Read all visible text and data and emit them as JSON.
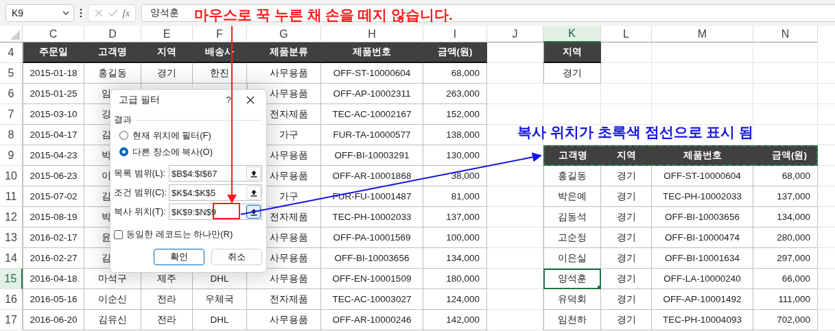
{
  "formula_bar": {
    "name_box": "K9",
    "function_label": "fx",
    "value": "양석훈"
  },
  "sheet": {
    "columns": [
      {
        "label": "C",
        "selected": false
      },
      {
        "label": "D",
        "selected": false
      },
      {
        "label": "E",
        "selected": false
      },
      {
        "label": "F",
        "selected": false
      },
      {
        "label": "G",
        "selected": false
      },
      {
        "label": "H",
        "selected": false
      },
      {
        "label": "I",
        "selected": false
      },
      {
        "label": "J",
        "selected": false
      },
      {
        "label": "K",
        "selected": true
      },
      {
        "label": "L",
        "selected": false
      },
      {
        "label": "M",
        "selected": false
      },
      {
        "label": "N",
        "selected": false
      }
    ],
    "rows": [
      {
        "label": "4",
        "selected": false,
        "copy_marquee": false,
        "cells": [
          {
            "kind": "header",
            "text": "주문일"
          },
          {
            "kind": "header",
            "text": "고객명"
          },
          {
            "kind": "header",
            "text": "지역"
          },
          {
            "kind": "header",
            "text": "배송사"
          },
          {
            "kind": "header",
            "text": "제품분류"
          },
          {
            "kind": "header",
            "text": "제품번호"
          },
          {
            "kind": "header",
            "text": "금액(원)"
          },
          null,
          {
            "kind": "header",
            "text": "지역"
          },
          null,
          null,
          null
        ]
      },
      {
        "label": "5",
        "selected": false,
        "copy_marquee": false,
        "cells": [
          {
            "kind": "text",
            "text": "2015-01-18"
          },
          {
            "kind": "text",
            "text": "홍길동"
          },
          {
            "kind": "text",
            "text": "경기"
          },
          {
            "kind": "text",
            "text": "한진"
          },
          {
            "kind": "text",
            "text": "사무용품"
          },
          {
            "kind": "text",
            "text": "OFF-ST-10000604"
          },
          {
            "kind": "number",
            "text": "68,000"
          },
          null,
          {
            "kind": "text",
            "text": "경기"
          },
          null,
          null,
          null
        ]
      },
      {
        "label": "6",
        "selected": false,
        "copy_marquee": false,
        "cells": [
          {
            "kind": "text",
            "text": "2015-01-25"
          },
          {
            "kind": "partial",
            "text": "임"
          },
          null,
          null,
          {
            "kind": "text",
            "text": "사무용품"
          },
          {
            "kind": "text",
            "text": "OFF-AP-10002311"
          },
          {
            "kind": "number",
            "text": "263,000"
          },
          null,
          null,
          null,
          null,
          null
        ]
      },
      {
        "label": "7",
        "selected": false,
        "copy_marquee": false,
        "cells": [
          {
            "kind": "text",
            "text": "2015-03-10"
          },
          {
            "kind": "partial",
            "text": "강"
          },
          null,
          null,
          {
            "kind": "text",
            "text": "전자제품"
          },
          {
            "kind": "text",
            "text": "TEC-AC-10002167"
          },
          {
            "kind": "number",
            "text": "152,000"
          },
          null,
          null,
          null,
          null,
          null
        ]
      },
      {
        "label": "8",
        "selected": false,
        "copy_marquee": false,
        "cells": [
          {
            "kind": "text",
            "text": "2015-04-17"
          },
          {
            "kind": "partial",
            "text": "김"
          },
          null,
          null,
          {
            "kind": "text",
            "text": "가구"
          },
          {
            "kind": "text",
            "text": "FUR-TA-10000577"
          },
          {
            "kind": "number",
            "text": "138,000"
          },
          null,
          null,
          null,
          null,
          null
        ]
      },
      {
        "label": "9",
        "selected": false,
        "copy_marquee": true,
        "cells": [
          {
            "kind": "text",
            "text": "2015-04-23"
          },
          {
            "kind": "partial",
            "text": "박"
          },
          null,
          null,
          {
            "kind": "text",
            "text": "사무용품"
          },
          {
            "kind": "text",
            "text": "OFF-BI-10003291"
          },
          {
            "kind": "number",
            "text": "130,000"
          },
          null,
          {
            "kind": "header",
            "text": "고객명"
          },
          {
            "kind": "header",
            "text": "지역"
          },
          {
            "kind": "header",
            "text": "제품번호"
          },
          {
            "kind": "header_right",
            "text": "금액(원)"
          }
        ]
      },
      {
        "label": "10",
        "selected": false,
        "copy_marquee": false,
        "cells": [
          {
            "kind": "text",
            "text": "2015-06-23"
          },
          {
            "kind": "partial",
            "text": "이"
          },
          null,
          null,
          {
            "kind": "text",
            "text": "사무용품"
          },
          {
            "kind": "text",
            "text": "OFF-AR-10001868"
          },
          {
            "kind": "number",
            "text": "38,000"
          },
          null,
          {
            "kind": "text",
            "text": "홍길동"
          },
          {
            "kind": "text",
            "text": "경기"
          },
          {
            "kind": "text",
            "text": "OFF-ST-10000604"
          },
          {
            "kind": "number",
            "text": "68,000"
          }
        ]
      },
      {
        "label": "11",
        "selected": false,
        "copy_marquee": false,
        "cells": [
          {
            "kind": "text",
            "text": "2015-07-02"
          },
          {
            "kind": "partial",
            "text": "김"
          },
          null,
          null,
          {
            "kind": "text",
            "text": "가구"
          },
          {
            "kind": "text",
            "text": "FUR-FU-10001487"
          },
          {
            "kind": "number",
            "text": "81,000"
          },
          null,
          {
            "kind": "text",
            "text": "박은예"
          },
          {
            "kind": "text",
            "text": "경기"
          },
          {
            "kind": "text",
            "text": "TEC-PH-10002033"
          },
          {
            "kind": "number",
            "text": "137,000"
          }
        ]
      },
      {
        "label": "12",
        "selected": false,
        "copy_marquee": false,
        "cells": [
          {
            "kind": "text",
            "text": "2015-08-19"
          },
          {
            "kind": "partial",
            "text": "박"
          },
          null,
          null,
          {
            "kind": "text",
            "text": "전자제품"
          },
          {
            "kind": "text",
            "text": "TEC-PH-10002033"
          },
          {
            "kind": "number",
            "text": "137,000"
          },
          null,
          {
            "kind": "text",
            "text": "김동석"
          },
          {
            "kind": "text",
            "text": "경기"
          },
          {
            "kind": "text",
            "text": "OFF-BI-10003656"
          },
          {
            "kind": "number",
            "text": "134,000"
          }
        ]
      },
      {
        "label": "13",
        "selected": false,
        "copy_marquee": false,
        "cells": [
          {
            "kind": "text",
            "text": "2016-02-17"
          },
          {
            "kind": "partial",
            "text": "윤"
          },
          null,
          null,
          {
            "kind": "text",
            "text": "사무용품"
          },
          {
            "kind": "text",
            "text": "OFF-PA-10001569"
          },
          {
            "kind": "number",
            "text": "100,000"
          },
          null,
          {
            "kind": "text",
            "text": "고순정"
          },
          {
            "kind": "text",
            "text": "경기"
          },
          {
            "kind": "text",
            "text": "OFF-BI-10000474"
          },
          {
            "kind": "number",
            "text": "280,000"
          }
        ]
      },
      {
        "label": "14",
        "selected": false,
        "copy_marquee": false,
        "cells": [
          {
            "kind": "text",
            "text": "2016-02-27"
          },
          {
            "kind": "partial",
            "text": "김"
          },
          null,
          null,
          {
            "kind": "text",
            "text": "사무용품"
          },
          {
            "kind": "text",
            "text": "OFF-BI-10003656"
          },
          {
            "kind": "number",
            "text": "134,000"
          },
          null,
          {
            "kind": "text",
            "text": "이은실"
          },
          {
            "kind": "text",
            "text": "경기"
          },
          {
            "kind": "text",
            "text": "OFF-BI-10001634"
          },
          {
            "kind": "number",
            "text": "297,000"
          }
        ]
      },
      {
        "label": "15",
        "selected": true,
        "copy_marquee": false,
        "cells": [
          {
            "kind": "text",
            "text": "2016-04-18"
          },
          {
            "kind": "text",
            "text": "마석구"
          },
          {
            "kind": "text",
            "text": "제주"
          },
          {
            "kind": "text",
            "text": "DHL"
          },
          {
            "kind": "text",
            "text": "사무용품"
          },
          {
            "kind": "text",
            "text": "OFF-EN-10001509"
          },
          {
            "kind": "number",
            "text": "180,000"
          },
          null,
          {
            "kind": "text",
            "text": "양석훈",
            "active": true
          },
          {
            "kind": "text",
            "text": "경기"
          },
          {
            "kind": "text",
            "text": "OFF-LA-10000240"
          },
          {
            "kind": "number",
            "text": "66,000"
          }
        ]
      },
      {
        "label": "16",
        "selected": false,
        "copy_marquee": false,
        "cells": [
          {
            "kind": "text",
            "text": "2016-05-16"
          },
          {
            "kind": "text",
            "text": "이순신"
          },
          {
            "kind": "text",
            "text": "전라"
          },
          {
            "kind": "text",
            "text": "우체국"
          },
          {
            "kind": "text",
            "text": "전자제품"
          },
          {
            "kind": "text",
            "text": "TEC-AC-10003027"
          },
          {
            "kind": "number",
            "text": "124,000"
          },
          null,
          {
            "kind": "text",
            "text": "유덕회"
          },
          {
            "kind": "text",
            "text": "경기"
          },
          {
            "kind": "text",
            "text": "OFF-AP-10001492"
          },
          {
            "kind": "number",
            "text": "111,000"
          }
        ]
      },
      {
        "label": "17",
        "selected": false,
        "copy_marquee": false,
        "cells": [
          {
            "kind": "text",
            "text": "2016-06-20"
          },
          {
            "kind": "text",
            "text": "김유신"
          },
          {
            "kind": "text",
            "text": "전라"
          },
          {
            "kind": "text",
            "text": "DHL"
          },
          {
            "kind": "text",
            "text": "사무용품"
          },
          {
            "kind": "text",
            "text": "OFF-AR-10000246"
          },
          {
            "kind": "number",
            "text": "142,000"
          },
          null,
          {
            "kind": "text",
            "text": "임천하"
          },
          {
            "kind": "text",
            "text": "경기"
          },
          {
            "kind": "text",
            "text": "TEC-PH-10004093"
          },
          {
            "kind": "number",
            "text": "702,000"
          }
        ]
      }
    ]
  },
  "dialog": {
    "title": "고급 필터",
    "help": "?",
    "group_label": "결과",
    "options": [
      {
        "label": "현재 위치에 필터(F)",
        "selected": false
      },
      {
        "label": "다른 장소에 복사(O)",
        "selected": true
      }
    ],
    "fields": [
      {
        "label": "목록 범위(L):",
        "value": "$B$4:$I$67",
        "focused": false
      },
      {
        "label": "조건 범위(C):",
        "value": "$K$4:$K$5",
        "focused": false
      },
      {
        "label": "복사 위치(T):",
        "value": "$K$9:$N$9",
        "focused": true
      }
    ],
    "unique_only": {
      "label": "동일한 레코드는 하나만(R)",
      "checked": false
    },
    "buttons": [
      {
        "label": "확인",
        "default": true
      },
      {
        "label": "취소",
        "default": false
      }
    ]
  },
  "annotations": {
    "press_hint": "마우스로 꾹 누른 채 손을 떼지 않습니다.",
    "marquee_note": "복사 위치가 초록색 점선으로 표시 됨"
  }
}
